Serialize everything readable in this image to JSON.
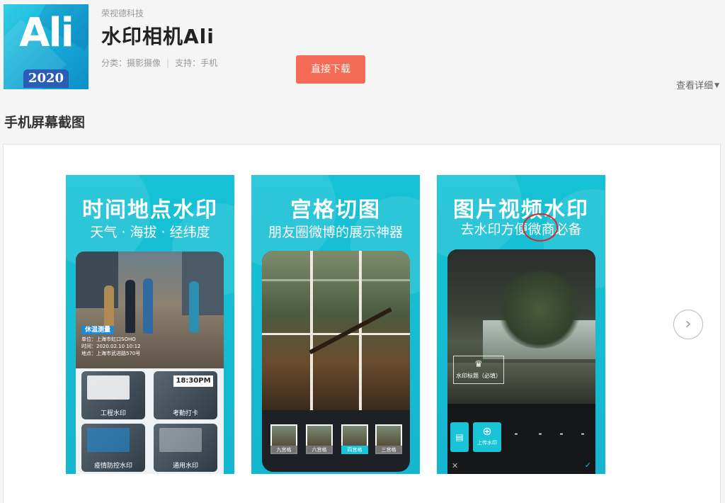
{
  "app": {
    "developer": "荣视德科技",
    "title": "水印相机Ali",
    "icon_text": "Ali",
    "icon_year": "2020",
    "category_label": "分类：",
    "category_value": "摄影摄像",
    "support_label": "支持：",
    "support_value": "手机",
    "download_label": "直接下载",
    "details_label": "查看详细"
  },
  "section": {
    "title": "手机屏幕截图"
  },
  "screenshots": [
    {
      "heading": "时间地点水印",
      "subheading": "天气 · 海拔 · 经纬度",
      "stamp_tag": "休温测量",
      "stamp_lines": [
        "单位：上海市虹口SOHO",
        "时间：2020.02.10 10:12",
        "地点：上海市武进路570号"
      ],
      "tiles": [
        "工程水印",
        "考勤打卡",
        "疫情防控水印",
        "通用水印"
      ],
      "tile_time": "18:30PM"
    },
    {
      "heading": "宫格切图",
      "subheading": "朋友圈微博的展示神器",
      "thumbs": [
        "九宫格",
        "六宫格",
        "四宫格",
        "三宫格"
      ]
    },
    {
      "heading": "图片视频水印",
      "subheading": "去水印方便微商必备",
      "label_box": "水印标题（必填）",
      "upload_label": "上传水印",
      "close_glyph": "✕",
      "confirm_glyph": "✓"
    }
  ],
  "colors": {
    "accent": "#f46c55",
    "shot_bg": "#16c2d6",
    "highlight": "#d8262b"
  },
  "icons": {
    "next": "chevron-right-icon"
  }
}
